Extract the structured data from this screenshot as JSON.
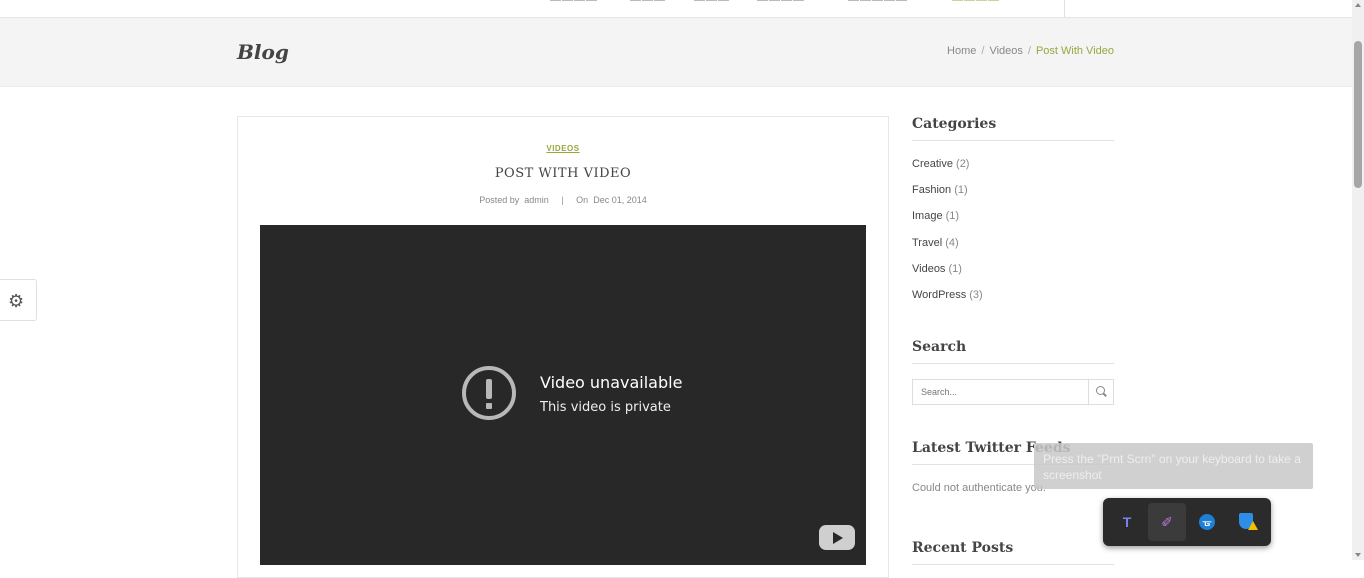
{
  "header": {
    "page_title": "Blog",
    "breadcrumb": [
      {
        "label": "Home"
      },
      {
        "label": "Videos"
      },
      {
        "label": "Post With Video"
      }
    ]
  },
  "post": {
    "category": "VIDEOS",
    "title": "POST WITH VIDEO",
    "meta": {
      "posted_by_label": "Posted by",
      "author": "admin",
      "on_label": "On",
      "date": "Dec 01, 2014"
    },
    "video": {
      "title": "Video unavailable",
      "subtitle": "This video is private",
      "play_logo_icon": "youtube-logo-icon"
    }
  },
  "sidebar": {
    "categories_heading": "Categories",
    "categories": [
      {
        "name": "Creative",
        "count": "(2)"
      },
      {
        "name": "Fashion",
        "count": "(1)"
      },
      {
        "name": "Image",
        "count": "(1)"
      },
      {
        "name": "Travel",
        "count": "(4)"
      },
      {
        "name": "Videos",
        "count": "(1)"
      },
      {
        "name": "WordPress",
        "count": "(3)"
      }
    ],
    "search_heading": "Search",
    "search_placeholder": "Search...",
    "twitter_heading": "Latest Twitter Feeds",
    "twitter_message": "Could not authenticate you.",
    "recent_heading": "Recent Posts"
  },
  "overlay": {
    "tooltip": "Press the \"Prnt Scrn\" on your keyboard to take a screenshot",
    "tray_icons": [
      "teams-icon",
      "pen-icon",
      "bluetooth-icon",
      "security-shield-icon"
    ]
  },
  "colors": {
    "accent": "#9aa640",
    "video_bg": "#282828",
    "title_bar_bg": "#f4f4f4"
  }
}
